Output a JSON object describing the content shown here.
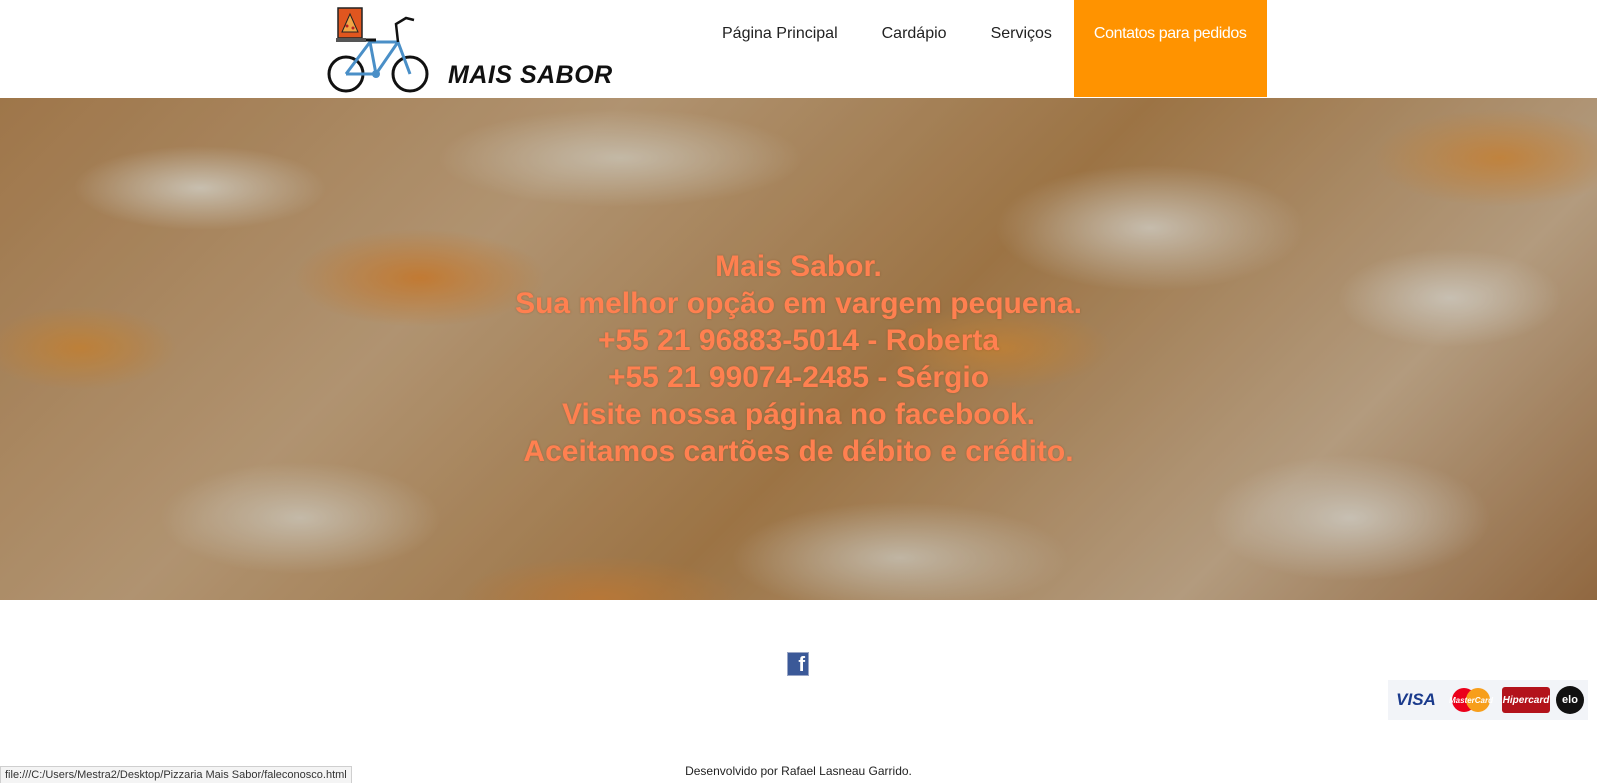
{
  "header": {
    "logo_text": "MAIS SABOR",
    "nav": [
      {
        "label": "Página Principal"
      },
      {
        "label": "Cardápio"
      },
      {
        "label": "Serviços"
      },
      {
        "label": "Contatos para pedidos",
        "active": true
      }
    ],
    "accent_color": "#ff9300"
  },
  "hero": {
    "lines": [
      "Mais Sabor.",
      "Sua melhor opção em vargem pequena.",
      "+55 21 96883-5014 - Roberta",
      "+55 21 99074-2485 - Sérgio",
      "Visite nossa página no facebook.",
      "Aceitamos cartões de débito e crédito."
    ],
    "text_color": "#ff8050"
  },
  "footer": {
    "facebook_icon": "facebook-icon",
    "cards": {
      "visa": "VISA",
      "mastercard": "MasterCard",
      "hipercard": "Hipercard",
      "elo": "elo"
    },
    "credit": "Desenvolvido por Rafael Lasneau Garrido."
  },
  "status_bar": {
    "url": "file:///C:/Users/Mestra2/Desktop/Pizzaria Mais Sabor/faleconosco.html"
  }
}
